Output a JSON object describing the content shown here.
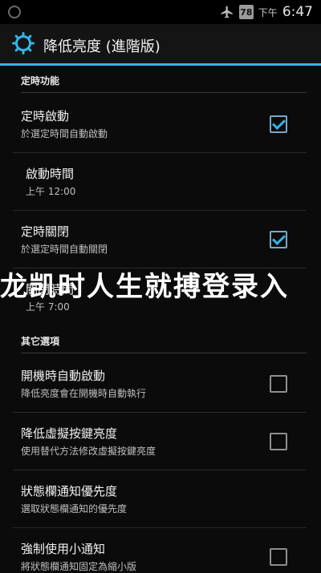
{
  "status_bar": {
    "battery": "78",
    "time_prefix": "下午",
    "time": "6:47"
  },
  "action_bar": {
    "title": "降低亮度 (進階版)"
  },
  "sections": {
    "timer": {
      "header": "定時功能",
      "start": {
        "title": "定時啟動",
        "summary": "於選定時間自動啟動",
        "checked": true
      },
      "start_time": {
        "title": "啟動時間",
        "summary": "上午 12:00"
      },
      "stop": {
        "title": "定時關閉",
        "summary": "於選定時間自動關閉",
        "checked": true
      },
      "stop_time": {
        "title": "關閉時間",
        "summary": "上午 7:00"
      }
    },
    "other": {
      "header": "其它選項",
      "boot": {
        "title": "開機時自動啟動",
        "summary": "降低亮度會在開機時自動執行",
        "checked": false
      },
      "dim_keys": {
        "title": "降低虛擬按鍵亮度",
        "summary": "使用替代方法修改虛擬按鍵亮度",
        "checked": false
      },
      "notif_priority": {
        "title": "狀態欄通知優先度",
        "summary": "選取狀態欄通知的優先度"
      },
      "small_notif": {
        "title": "強制使用小通知",
        "summary": "將狀態欄通知固定為縮小版",
        "checked": false
      }
    }
  },
  "overlay_text": "龙凯时人生就搏登录入"
}
